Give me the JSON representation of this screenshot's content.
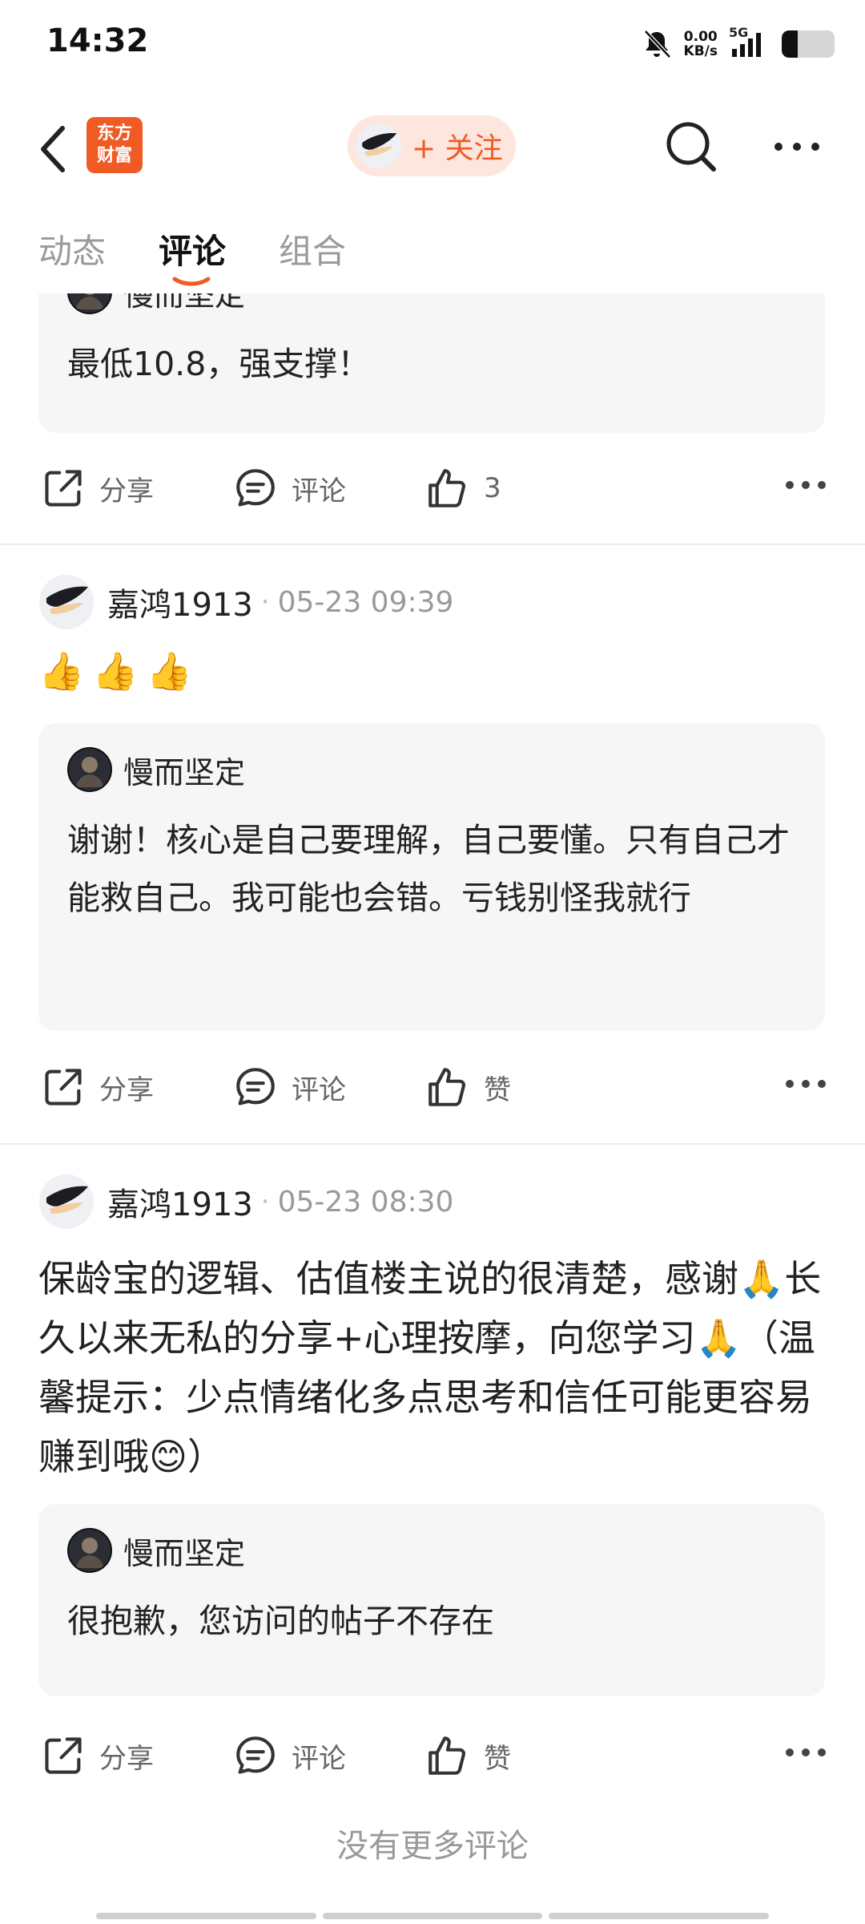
{
  "status_bar": {
    "time": "14:32",
    "net_speed_value": "0.00",
    "net_speed_unit": "KB/s",
    "network": "5G",
    "battery_level": 0.3
  },
  "header": {
    "logo_line1": "东方",
    "logo_line2": "财富",
    "follow_label": "+ 关注",
    "brand_color": "#f05b25"
  },
  "tabs": [
    {
      "label": "动态",
      "active": false
    },
    {
      "label": "评论",
      "active": true
    },
    {
      "label": "组合",
      "active": false
    }
  ],
  "posts": [
    {
      "reply": {
        "name": "慢而坚定",
        "text": "最低10.8，强支撑！"
      },
      "actions": {
        "share": "分享",
        "comment": "评论",
        "like": "3"
      }
    },
    {
      "author": "嘉鸿1913",
      "time": "05-23 09:39",
      "emojis": [
        "👍",
        "👍",
        "👍"
      ],
      "reply": {
        "name": "慢而坚定",
        "text": "谢谢！核心是自己要理解，自己要懂。只有自己才能救自己。我可能也会错。亏钱别怪我就行"
      },
      "actions": {
        "share": "分享",
        "comment": "评论",
        "like": "赞"
      }
    },
    {
      "author": "嘉鸿1913",
      "time": "05-23 08:30",
      "text_part1": "保龄宝的逻辑、估值楼主说的很清楚，感谢",
      "emoji1": "🙏",
      "text_part2": "长久以来无私的分享+心理按摩，向您学习",
      "emoji2": "🙏",
      "text_part3": "（温馨提示：少点情绪化多点思考和信任可能更容易赚到哦",
      "emoji3": "😊",
      "text_part4": "）",
      "reply": {
        "name": "慢而坚定",
        "text": "很抱歉，您访问的帖子不存在"
      },
      "actions": {
        "share": "分享",
        "comment": "评论",
        "like": "赞"
      }
    }
  ],
  "footer_text": "没有更多评论"
}
